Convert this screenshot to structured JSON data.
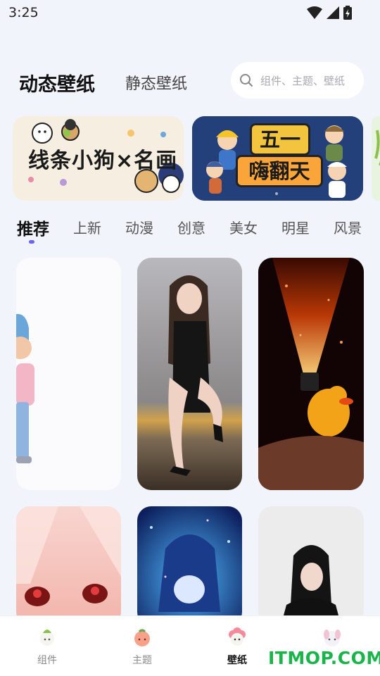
{
  "status_bar": {
    "time": "3:25"
  },
  "header": {
    "tabs": [
      {
        "label": "动态壁纸",
        "active": true
      },
      {
        "label": "静态壁纸",
        "active": false
      }
    ],
    "search": {
      "placeholder": "组件、主题、壁纸"
    }
  },
  "banners": [
    {
      "text": "线条小狗×名画"
    },
    {
      "line1": "五一",
      "line2": "嗨翻天"
    }
  ],
  "categories": [
    {
      "label": "推荐",
      "active": true
    },
    {
      "label": "上新"
    },
    {
      "label": "动漫"
    },
    {
      "label": "创意"
    },
    {
      "label": "美女"
    },
    {
      "label": "明星"
    },
    {
      "label": "风景"
    }
  ],
  "wallpapers": [
    {
      "subject": "cartoon-figure"
    },
    {
      "subject": "woman-in-black-dress"
    },
    {
      "subject": "flashlight-duck"
    },
    {
      "subject": "anime-girl-eyes"
    },
    {
      "subject": "anime-girl-blue"
    },
    {
      "subject": "woman-portrait"
    }
  ],
  "bottom_nav": [
    {
      "label": "组件",
      "icon": "widget-icon"
    },
    {
      "label": "主题",
      "icon": "theme-icon"
    },
    {
      "label": "壁纸",
      "icon": "wallpaper-icon",
      "active": true
    },
    {
      "label": "",
      "icon": "avatar-icon"
    }
  ],
  "watermark": "ITMOP.COM",
  "colors": {
    "accent": "#6c63ff",
    "background": "#f2f4fc",
    "watermark": "#1ab44a"
  }
}
